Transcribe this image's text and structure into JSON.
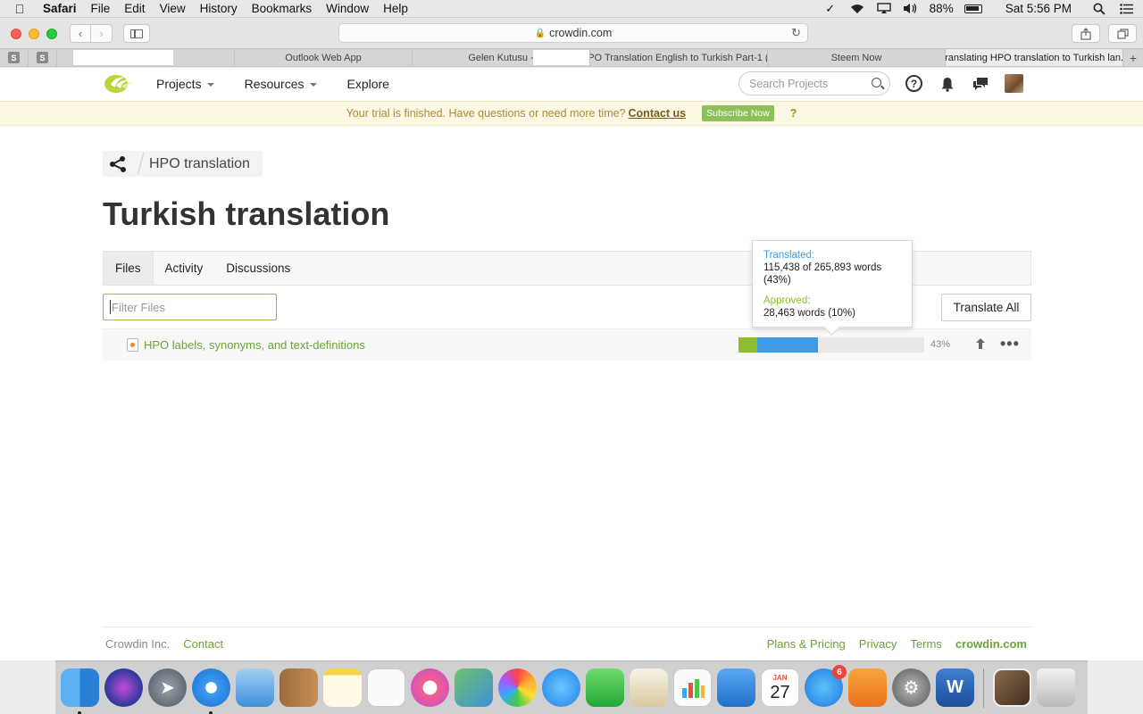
{
  "menubar": {
    "app": "Safari",
    "items": [
      "File",
      "Edit",
      "View",
      "History",
      "Bookmarks",
      "Window",
      "Help"
    ],
    "battery": "88%",
    "clock": "Sat 5:56 PM"
  },
  "browser": {
    "url": "crowdin.com",
    "pinned": [
      "S",
      "S"
    ],
    "tabs": [
      "",
      "Outlook Web App",
      "Gelen Kutusu -",
      "HPO Translation English to Turkish Part-1 (...",
      "Steem Now",
      "Translating HPO translation to Turkish lan..."
    ],
    "tab_plus": "+"
  },
  "header": {
    "nav": [
      "Projects",
      "Resources",
      "Explore"
    ],
    "search_placeholder": "Search Projects",
    "help_icon": "?"
  },
  "trial": {
    "message": "Your trial is finished. Have questions or need more time?",
    "contact": "Contact us",
    "subscribe": "Subscribe Now",
    "question": "?"
  },
  "breadcrumb": {
    "project": "HPO translation"
  },
  "page_title": "Turkish translation",
  "tabs": [
    "Files",
    "Activity",
    "Discussions"
  ],
  "filter_placeholder": "Filter Files",
  "translate_all": "Translate All",
  "file": {
    "name": "HPO labels, synonyms, and text-definitions",
    "percent": "43%",
    "approved_fraction": 0.1,
    "translated_fraction": 0.43,
    "more": "•••"
  },
  "tooltip": {
    "translated_label": "Translated:",
    "translated_value": "115,438 of 265,893 words (43%)",
    "approved_label": "Approved:",
    "approved_value": "28,463 words (10%)"
  },
  "footer": {
    "company": "Crowdin Inc.",
    "contact": "Contact",
    "links": [
      "Plans & Pricing",
      "Privacy",
      "Terms"
    ],
    "brand": "crowdin.com"
  },
  "dock": {
    "calendar_month": "JAN",
    "calendar_day": "27",
    "appstore_badge": "6",
    "word_letter": "W"
  },
  "colors": {
    "crowdin_green": "#6aa33a",
    "approved": "#8cbf2b",
    "translated": "#3d9be9"
  }
}
